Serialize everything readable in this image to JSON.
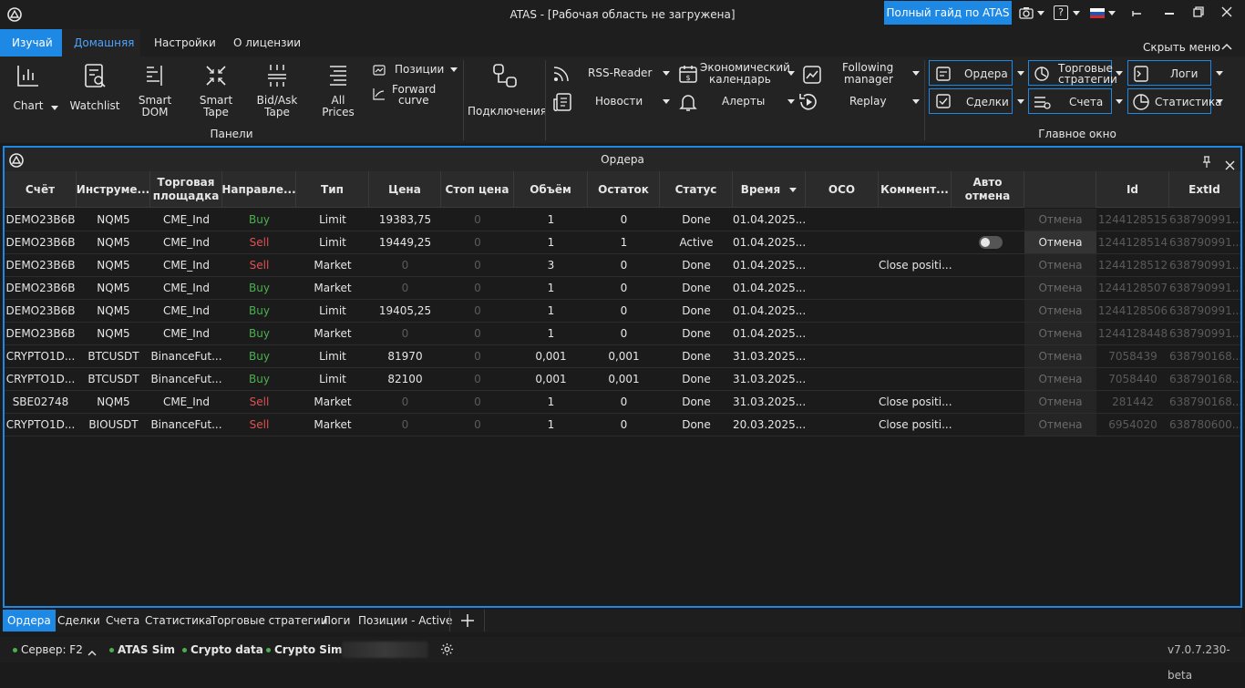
{
  "window": {
    "title": "ATAS - [Рабочая область не загружена]",
    "guide_button": "Полный гайд по ATAS"
  },
  "menu": {
    "tabs": [
      "Изучай",
      "Домашняя",
      "Настройки",
      "О лицензии"
    ],
    "hide_menu": "Скрыть меню"
  },
  "ribbon": {
    "chart": "Chart",
    "watchlist": "Watchlist",
    "smart_dom": [
      "Smart",
      "DOM"
    ],
    "smart_tape": [
      "Smart",
      "Tape"
    ],
    "bidask_tape": [
      "Bid/Ask",
      "Tape"
    ],
    "all_prices": [
      "All",
      "Prices"
    ],
    "positions": "Позиции",
    "forward_curve": [
      "Forward",
      "curve"
    ],
    "panels_group": "Панели",
    "connections": "Подключения",
    "rss": "RSS-Reader",
    "news": "Новости",
    "econ_calendar": [
      "Экономический",
      "календарь"
    ],
    "alerts": "Алерты",
    "following_manager": [
      "Following",
      "manager"
    ],
    "replay": "Replay",
    "orders": "Ордера",
    "trades": "Сделки",
    "trading_strategies": [
      "Торговые",
      "стратегии"
    ],
    "accounts": "Счета",
    "logs": "Логи",
    "statistics": "Статистика",
    "main_window_group": "Главное окно"
  },
  "orders_panel": {
    "title": "Ордера",
    "columns": [
      "Счёт",
      "Инструме...",
      "Торговая площадка",
      "Направле...",
      "Тип",
      "Цена",
      "Стоп цена",
      "Объём",
      "Остаток",
      "Статус",
      "Время",
      "OCO",
      "Коммент...",
      "Авто отмена",
      "",
      "Id",
      "ExtId"
    ],
    "rows": [
      {
        "account": "DEMO23B6B",
        "instrument": "NQM5",
        "exchange": "CME_Ind",
        "direction": "Buy",
        "type": "Limit",
        "price": "19383,75",
        "stop": "0",
        "volume": "1",
        "remaining": "0",
        "status": "Done",
        "time": "01.04.2025...",
        "comment": "",
        "cancel": "Отмена",
        "id": "1244128515",
        "extid": "638790991..."
      },
      {
        "account": "DEMO23B6B",
        "instrument": "NQM5",
        "exchange": "CME_Ind",
        "direction": "Sell",
        "type": "Limit",
        "price": "19449,25",
        "stop": "0",
        "volume": "1",
        "remaining": "1",
        "status": "Active",
        "time": "01.04.2025...",
        "comment": "",
        "cancel": "Отмена",
        "id": "1244128514",
        "extid": "638790991..."
      },
      {
        "account": "DEMO23B6B",
        "instrument": "NQM5",
        "exchange": "CME_Ind",
        "direction": "Sell",
        "type": "Market",
        "price": "0",
        "stop": "0",
        "volume": "3",
        "remaining": "0",
        "status": "Done",
        "time": "01.04.2025...",
        "comment": "Close positi...",
        "cancel": "Отмена",
        "id": "1244128512",
        "extid": "638790991..."
      },
      {
        "account": "DEMO23B6B",
        "instrument": "NQM5",
        "exchange": "CME_Ind",
        "direction": "Buy",
        "type": "Market",
        "price": "0",
        "stop": "0",
        "volume": "1",
        "remaining": "0",
        "status": "Done",
        "time": "01.04.2025...",
        "comment": "",
        "cancel": "Отмена",
        "id": "1244128507",
        "extid": "638790991..."
      },
      {
        "account": "DEMO23B6B",
        "instrument": "NQM5",
        "exchange": "CME_Ind",
        "direction": "Buy",
        "type": "Limit",
        "price": "19405,25",
        "stop": "0",
        "volume": "1",
        "remaining": "0",
        "status": "Done",
        "time": "01.04.2025...",
        "comment": "",
        "cancel": "Отмена",
        "id": "1244128506",
        "extid": "638790991..."
      },
      {
        "account": "DEMO23B6B",
        "instrument": "NQM5",
        "exchange": "CME_Ind",
        "direction": "Buy",
        "type": "Market",
        "price": "0",
        "stop": "0",
        "volume": "1",
        "remaining": "0",
        "status": "Done",
        "time": "01.04.2025...",
        "comment": "",
        "cancel": "Отмена",
        "id": "1244128448",
        "extid": "638790991..."
      },
      {
        "account": "CRYPTO1D...",
        "instrument": "BTCUSDT",
        "exchange": "BinanceFut...",
        "direction": "Buy",
        "type": "Limit",
        "price": "81970",
        "stop": "0",
        "volume": "0,001",
        "remaining": "0,001",
        "status": "Done",
        "time": "31.03.2025...",
        "comment": "",
        "cancel": "Отмена",
        "id": "7058439",
        "extid": "638790168..."
      },
      {
        "account": "CRYPTO1D...",
        "instrument": "BTCUSDT",
        "exchange": "BinanceFut...",
        "direction": "Buy",
        "type": "Limit",
        "price": "82100",
        "stop": "0",
        "volume": "0,001",
        "remaining": "0,001",
        "status": "Done",
        "time": "31.03.2025...",
        "comment": "",
        "cancel": "Отмена",
        "id": "7058440",
        "extid": "638790168..."
      },
      {
        "account": "SBE02748",
        "instrument": "NQM5",
        "exchange": "CME_Ind",
        "direction": "Sell",
        "type": "Market",
        "price": "0",
        "stop": "0",
        "volume": "1",
        "remaining": "0",
        "status": "Done",
        "time": "31.03.2025...",
        "comment": "Close positi...",
        "cancel": "Отмена",
        "id": "281442",
        "extid": "638790168..."
      },
      {
        "account": "CRYPTO1D...",
        "instrument": "BIOUSDT",
        "exchange": "BinanceFut...",
        "direction": "Sell",
        "type": "Market",
        "price": "0",
        "stop": "0",
        "volume": "1",
        "remaining": "0",
        "status": "Done",
        "time": "20.03.2025...",
        "comment": "Close positi...",
        "cancel": "Отмена",
        "id": "6954020",
        "extid": "638780600..."
      }
    ]
  },
  "bottom_tabs": [
    "Ордера",
    "Сделки",
    "Счета",
    "Статистика",
    "Торговые стратегии",
    "Логи",
    "Позиции - Active"
  ],
  "status": {
    "server": "Сервер: F2",
    "atas_sim": "ATAS Sim",
    "crypto_data": "Crypto data",
    "crypto_sim": "Crypto Sim",
    "version": "v7.0.7.230-beta"
  },
  "colors": {
    "accent": "#1e88e5",
    "buy": "#4caf50",
    "sell": "#e05252"
  }
}
